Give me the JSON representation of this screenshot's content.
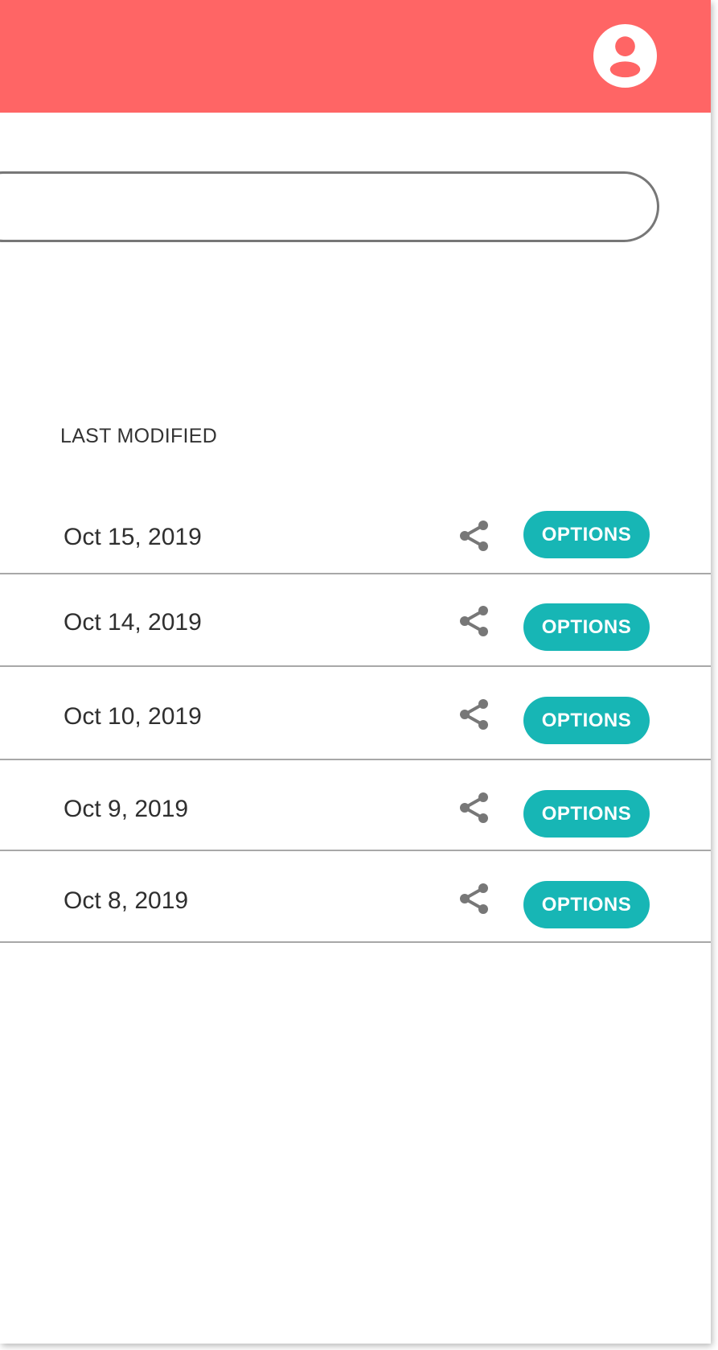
{
  "header": {
    "color": "#ff6565",
    "avatar_icon": "user-circle-icon"
  },
  "search": {
    "value": "",
    "placeholder": ""
  },
  "table": {
    "column_header": "LAST MODIFIED",
    "rows": [
      {
        "date": "Oct 15, 2019",
        "share_icon": "share-icon",
        "options_label": "OPTIONS"
      },
      {
        "date": "Oct 14, 2019",
        "share_icon": "share-icon",
        "options_label": "OPTIONS"
      },
      {
        "date": "Oct 10, 2019",
        "share_icon": "share-icon",
        "options_label": "OPTIONS"
      },
      {
        "date": "Oct 9, 2019",
        "share_icon": "share-icon",
        "options_label": "OPTIONS"
      },
      {
        "date": "Oct 8, 2019",
        "share_icon": "share-icon",
        "options_label": "OPTIONS"
      }
    ]
  },
  "colors": {
    "accent": "#17b6b5",
    "icon_gray": "#777777",
    "divider": "#a8a8a8"
  }
}
